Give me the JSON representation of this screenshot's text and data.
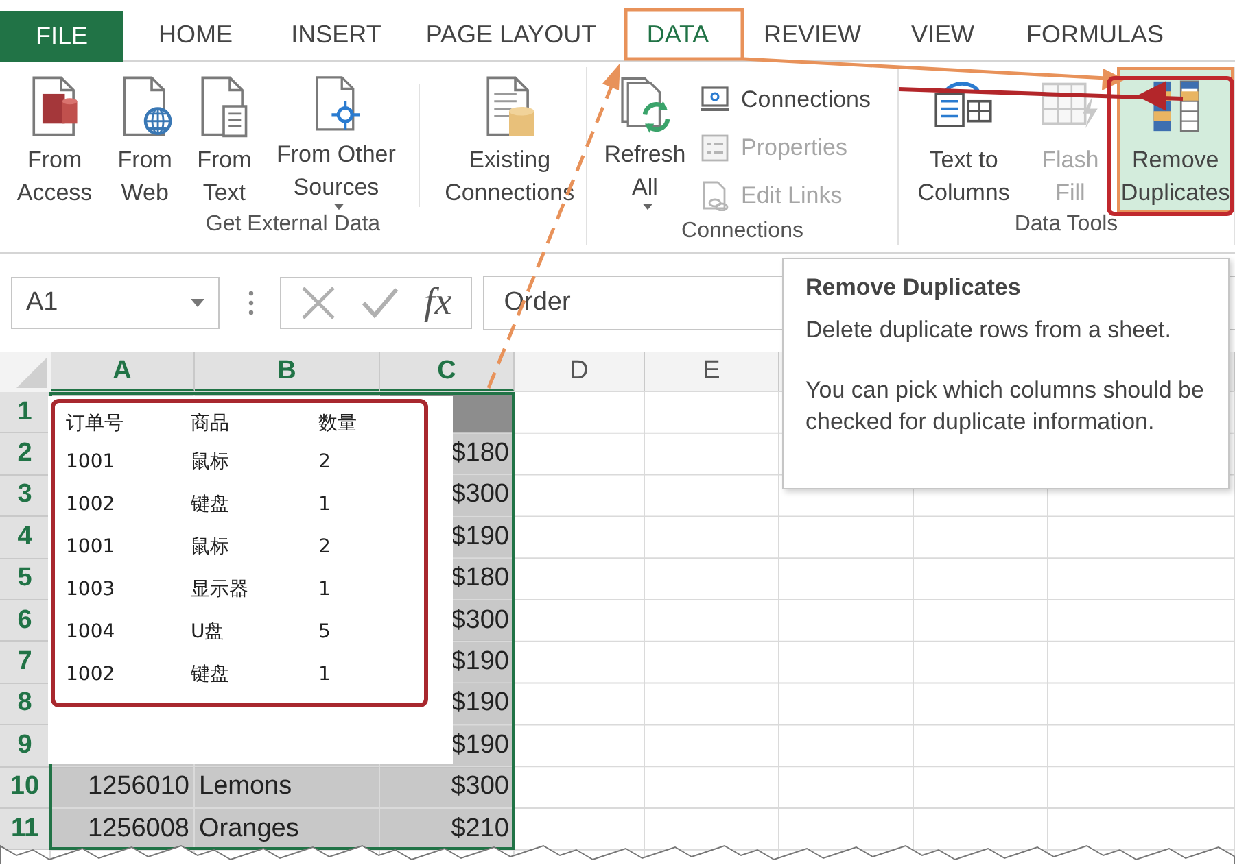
{
  "ribbon_tabs": [
    {
      "label": "FILE",
      "kind": "file",
      "selected": false
    },
    {
      "label": "HOME",
      "kind": "tab",
      "selected": false
    },
    {
      "label": "INSERT",
      "kind": "tab",
      "selected": false
    },
    {
      "label": "PAGE LAYOUT",
      "kind": "tab",
      "selected": false
    },
    {
      "label": "DATA",
      "kind": "tab",
      "selected": true
    },
    {
      "label": "REVIEW",
      "kind": "tab",
      "selected": false
    },
    {
      "label": "VIEW",
      "kind": "tab",
      "selected": false
    },
    {
      "label": "FORMULAS",
      "kind": "tab",
      "selected": false
    }
  ],
  "ribbon_groups": [
    {
      "label": "Get External Data",
      "commands": [
        {
          "kind": "large",
          "label": "From Access",
          "disabled": false
        },
        {
          "kind": "large",
          "label": "From Web",
          "disabled": false
        },
        {
          "kind": "large",
          "label": "From Text",
          "disabled": false
        },
        {
          "kind": "large",
          "label": "From Other Sources",
          "dropdown": true,
          "disabled": false
        },
        {
          "kind": "large",
          "label": "Existing Connections",
          "separator_before": true,
          "disabled": false
        }
      ]
    },
    {
      "label": "Connections",
      "commands": [
        {
          "kind": "large",
          "label": "Refresh All",
          "dropdown": true,
          "disabled": false
        },
        {
          "kind": "small",
          "label": "Connections",
          "disabled": false
        },
        {
          "kind": "small",
          "label": "Properties",
          "disabled": true
        },
        {
          "kind": "small",
          "label": "Edit Links",
          "disabled": true
        }
      ]
    },
    {
      "label": "Data Tools",
      "commands": [
        {
          "kind": "large",
          "label": "Text to Columns",
          "disabled": false
        },
        {
          "kind": "large",
          "label": "Flash Fill",
          "disabled": true
        },
        {
          "kind": "large",
          "label": "Remove Duplicates",
          "highlighted": true,
          "disabled": false
        }
      ]
    }
  ],
  "formula_bar": {
    "name_box": "A1",
    "function_button": "fx",
    "formula": "Order"
  },
  "sheet": {
    "columns": [
      {
        "label": "A",
        "selected": true
      },
      {
        "label": "B",
        "selected": true
      },
      {
        "label": "C",
        "selected": true
      },
      {
        "label": "D",
        "selected": false
      },
      {
        "label": "E",
        "selected": false
      }
    ],
    "rows": [
      {
        "number": "1",
        "kind": "header",
        "selected": true
      },
      {
        "number": "2",
        "kind": "data",
        "selected": true,
        "c": "$180"
      },
      {
        "number": "3",
        "kind": "data",
        "selected": true,
        "c": "$300"
      },
      {
        "number": "4",
        "kind": "data",
        "selected": true,
        "c": "$190"
      },
      {
        "number": "5",
        "kind": "data",
        "selected": true,
        "c": "$180"
      },
      {
        "number": "6",
        "kind": "data",
        "selected": true,
        "c": "$300"
      },
      {
        "number": "7",
        "kind": "data",
        "selected": true,
        "c": "$190"
      },
      {
        "number": "8",
        "kind": "data",
        "selected": true,
        "c": "$190"
      },
      {
        "number": "9",
        "kind": "data",
        "selected": true,
        "c": "$190"
      },
      {
        "number": "10",
        "kind": "data",
        "selected": true,
        "a": "1256010",
        "b": "Lemons",
        "c": "$300"
      },
      {
        "number": "11",
        "kind": "data",
        "selected": true,
        "a": "1256008",
        "b": "Oranges",
        "c": "$210"
      }
    ]
  },
  "callout_table": {
    "columns": [
      "订单号",
      "商品",
      "数量"
    ],
    "rows": [
      [
        "1001",
        "鼠标",
        "2"
      ],
      [
        "1002",
        "键盘",
        "1"
      ],
      [
        "1001",
        "鼠标",
        "2"
      ],
      [
        "1003",
        "显示器",
        "1"
      ],
      [
        "1004",
        "U盘",
        "5"
      ],
      [
        "1002",
        "键盘",
        "1"
      ]
    ]
  },
  "tooltip": {
    "title": "Remove Duplicates",
    "lines": [
      "Delete duplicate rows from a sheet.",
      "You can pick which columns should be checked for duplicate information."
    ]
  }
}
